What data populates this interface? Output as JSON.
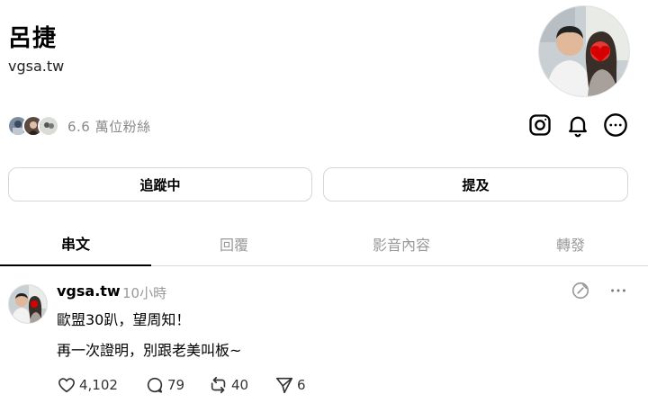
{
  "profile": {
    "name": "呂捷",
    "handle": "vgsa.tw",
    "followers_text": "6.6 萬位粉絲"
  },
  "icons": {
    "instagram": "instagram-icon",
    "notifications": "bell-icon",
    "more": "more-circle-icon"
  },
  "buttons": {
    "follow_label": "追蹤中",
    "mention_label": "提及"
  },
  "tabs": [
    {
      "label": "串文",
      "active": true
    },
    {
      "label": "回覆",
      "active": false
    },
    {
      "label": "影音內容",
      "active": false
    },
    {
      "label": "轉發",
      "active": false
    }
  ],
  "post": {
    "username": "vgsa.tw",
    "time": "10小時",
    "line1": "歐盟30趴，望周知！",
    "line2": "再一次證明，別跟老美叫板~",
    "likes": "4,102",
    "replies": "79",
    "reposts": "40",
    "shares": "6"
  },
  "colors": {
    "muted": "#999999",
    "border": "#d6d6d6",
    "text": "#000000"
  }
}
